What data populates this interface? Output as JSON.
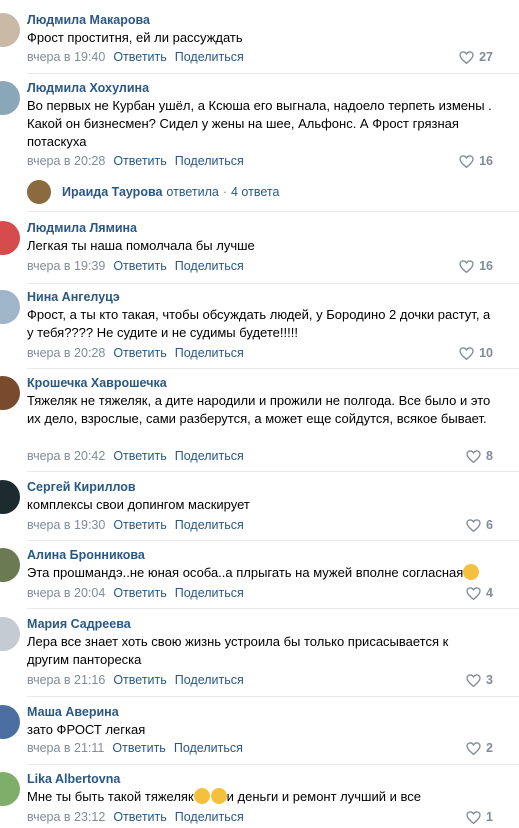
{
  "comments": [
    {
      "name": "Людмила Макарова",
      "text": "Фрост проститня, ей ли рассуждать",
      "time": "вчера в 19:40",
      "likes": "27",
      "avatar_color": "#c9b9a6"
    },
    {
      "name": "Людмила Хохулина",
      "text": "Во первых не Курбан ушёл, а Ксюша его выгнала, надоело терпеть измены . Какой он бизнесмен? Сидел у жены на шее, Альфонс. А Фрост грязная потаскуха",
      "time": "вчера в 20:28",
      "likes": "16",
      "avatar_color": "#8aa7b8"
    },
    {
      "name": "Людмила Лямина",
      "text": "Легкая ты наша помолчала бы лучше",
      "time": "вчера в 19:39",
      "likes": "16",
      "avatar_color": "#d64b4b"
    },
    {
      "name": "Нина Ангелуцэ",
      "text": "Фрост, а ты кто такая, чтобы обсуждать людей, у Бородино 2 дочки растут, а у тебя???? Не судите и не судимы будете!!!!!",
      "time": "вчера в 20:28",
      "likes": "10",
      "avatar_color": "#9fb6c9"
    },
    {
      "name": "Крошечка Хаврошечка",
      "text": "Тяжеляк не тяжеляк, а дите народили и прожили не полгода. Все было и это их дело, взрослые, сами разберутся, а может еще сойдутся, всякое бывает.",
      "time": "вчера в 20:42",
      "likes": "8",
      "avatar_color": "#7a4a2e"
    },
    {
      "name": "Сергей Кириллов",
      "text": "комплексы свои допингом маскирует",
      "time": "вчера в 19:30",
      "likes": "6",
      "avatar_color": "#1d2a2e"
    },
    {
      "name": "Алина Бронникова",
      "text": "Эта прошмандэ..не юная особа..а плрыгать на мужей вполне согласная",
      "time": "вчера в 20:04",
      "likes": "4",
      "avatar_color": "#6b7a52"
    },
    {
      "name": "Мария Садреева",
      "text": "Лера все знает хоть свою жизнь устроила бы только присасывается к другим пантореска",
      "time": "вчера в 21:16",
      "likes": "3",
      "avatar_color": "#c5cbd3"
    },
    {
      "name": "Маша Аверина",
      "text": "зато ФРОСТ легкая",
      "time": "вчера в 21:11",
      "likes": "2",
      "avatar_color": "#4a6ea0"
    },
    {
      "name": "Lika Albertovna",
      "text": "Мне ты быть такой тяжеляк",
      "text_after": "и деньги и ремонт лучший и все",
      "time": "вчера в 23:12",
      "likes": "1",
      "avatar_color": "#7fae6a"
    }
  ],
  "reply_thread": {
    "name": "Ираида Таурова",
    "verb": "ответила",
    "separator": "·",
    "count": "4 ответа",
    "avatar_color": "#8a6a3e"
  },
  "actions": {
    "reply": "Ответить",
    "share": "Поделиться"
  },
  "icons": {
    "like": "heart-outline-icon",
    "emoji": "emoji-face-icon"
  },
  "colors": {
    "link": "#2a5885",
    "meta": "#818c99",
    "divider": "#e7e8ec"
  }
}
